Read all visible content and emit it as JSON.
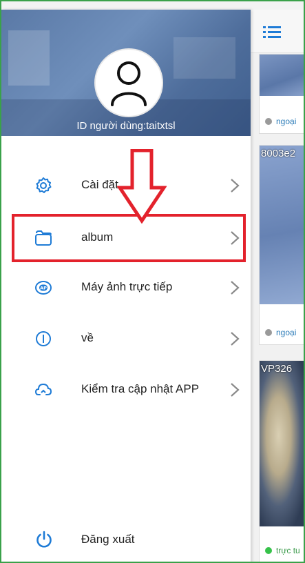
{
  "drawer": {
    "user_id": "ID người dùng:taitxtsl",
    "menu": [
      {
        "label": "Cài đặt",
        "icon": "gear-icon"
      },
      {
        "label": "album",
        "icon": "folder-icon"
      },
      {
        "label": "Máy ảnh trực tiếp",
        "icon": "ap-icon"
      },
      {
        "label": "về",
        "icon": "info-icon"
      },
      {
        "label": "Kiểm tra cập nhật APP",
        "icon": "cloud-sync-icon"
      }
    ],
    "logout_label": "Đăng xuất"
  },
  "background": {
    "cards": [
      {
        "status": "ngoại",
        "status_color": "#9a9a9a"
      },
      {
        "id": "8003e2",
        "status": "ngoại",
        "status_color": "#9a9a9a"
      },
      {
        "id": "VP326",
        "status": "trực tu",
        "status_color": "#36c24a"
      }
    ]
  },
  "colors": {
    "accent": "#1e7bd6",
    "highlight": "#e3222c",
    "frame": "#3aa14a"
  }
}
